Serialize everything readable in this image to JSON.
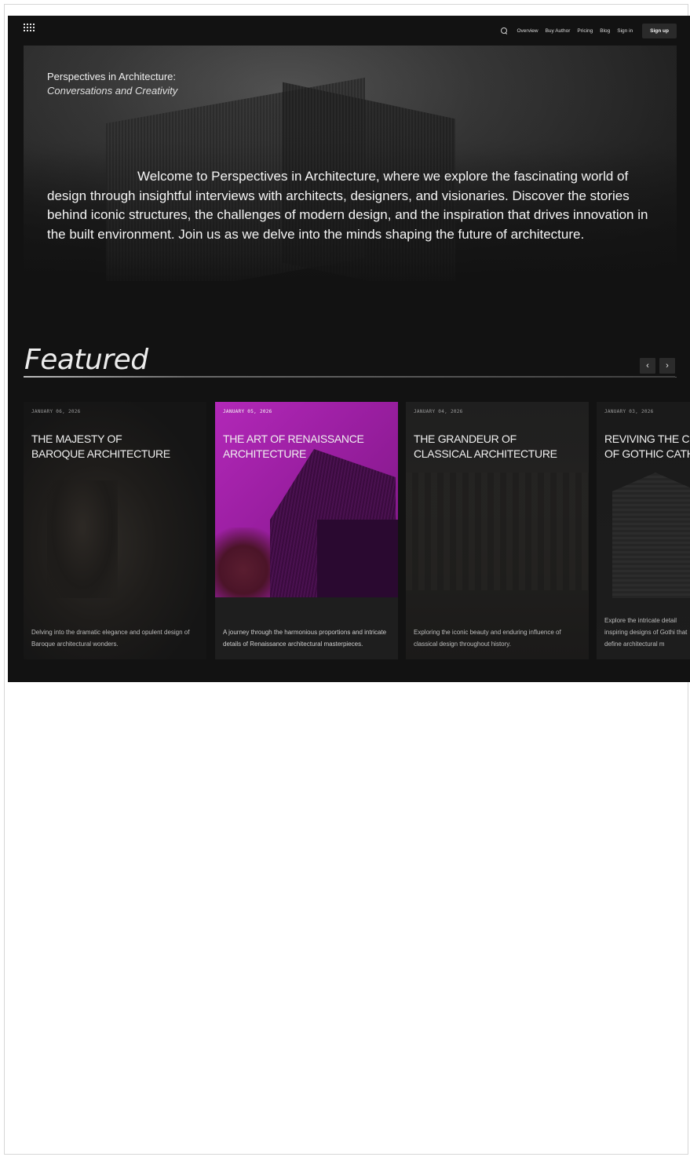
{
  "nav": {
    "links": [
      "Overview",
      "Buy Author",
      "Pricing",
      "Blog",
      "Sign in"
    ],
    "signup_label": "Sign up"
  },
  "hero": {
    "title": "Perspectives in Architecture:",
    "subtitle": "Conversations and Creativity",
    "body": "Welcome to Perspectives in Architecture, where we explore the fascinating world of design through insightful interviews with architects, designers, and visionaries. Discover the stories behind iconic structures, the challenges of modern design, and the inspiration that drives innovation in the built environment. Join us as we delve into the minds shaping the future of architecture."
  },
  "featured": {
    "heading": "Featured",
    "prev_label": "‹",
    "next_label": "›",
    "cards": [
      {
        "date": "JANUARY 06, 2026",
        "title_line1": "THE MAJESTY OF",
        "title_line2": "BAROQUE ARCHITECTURE",
        "description": "Delving into the dramatic elegance and opulent design of Baroque architectural wonders."
      },
      {
        "date": "JANUARY 05, 2026",
        "title_line1": "THE ART OF RENAISSANCE",
        "title_line2": "ARCHITECTURE",
        "description": "A journey through the harmonious proportions and intricate details of Renaissance architectural masterpieces.",
        "accent": "#b228b8"
      },
      {
        "date": "JANUARY 04, 2026",
        "title_line1": "THE GRANDEUR OF",
        "title_line2": "CLASSICAL ARCHITECTURE",
        "description": "Exploring the iconic beauty and enduring influence of classical design throughout history."
      },
      {
        "date": "JANUARY 03, 2026",
        "title_line1": "REVIVING THE CH",
        "title_line2": "OF GOTHIC CATH",
        "description": "Explore the intricate detail inspiring designs of Gothi that define architectural m"
      }
    ]
  },
  "colors": {
    "background": "#121212",
    "accent_magenta": "#b228b8",
    "text": "#f0f0f0"
  },
  "icons": {
    "logo": "grid-dots-icon",
    "search": "search-icon",
    "prev": "chevron-left-icon",
    "next": "chevron-right-icon"
  }
}
